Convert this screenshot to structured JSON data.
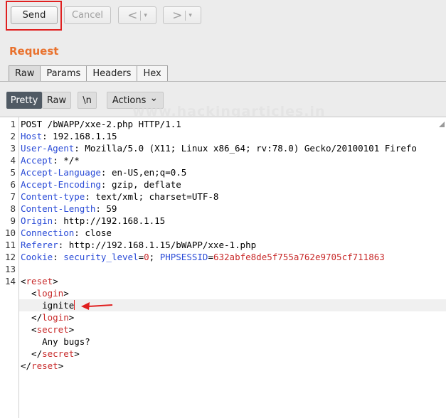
{
  "toolbar": {
    "send_label": "Send",
    "cancel_label": "Cancel",
    "back_glyph": "<",
    "forward_glyph": ">",
    "dropdown_glyph": "▾"
  },
  "request": {
    "title": "Request",
    "tabs": [
      "Raw",
      "Params",
      "Headers",
      "Hex"
    ],
    "active_tab": "Raw"
  },
  "viewbar": {
    "pretty_label": "Pretty",
    "raw_label": "Raw",
    "newline_label": "\\n",
    "actions_label": "Actions",
    "actions_glyph": "⌄"
  },
  "watermark": "www.hackingarticles.in",
  "editor": {
    "lines": [
      {
        "n": "1",
        "text": "POST /bWAPP/xxe-2.php HTTP/1.1"
      },
      {
        "n": "2",
        "key": "Host",
        "value": " 192.168.1.15"
      },
      {
        "n": "3",
        "key": "User-Agent",
        "value": " Mozilla/5.0 (X11; Linux x86_64; rv:78.0) Gecko/20100101 Firefo"
      },
      {
        "n": "4",
        "key": "Accept",
        "value": " */*"
      },
      {
        "n": "5",
        "key": "Accept-Language",
        "value": " en-US,en;q=0.5"
      },
      {
        "n": "6",
        "key": "Accept-Encoding",
        "value": " gzip, deflate"
      },
      {
        "n": "7",
        "key": "Content-type",
        "value": " text/xml; charset=UTF-8"
      },
      {
        "n": "8",
        "key": "Content-Length",
        "value": " 59"
      },
      {
        "n": "9",
        "key": "Origin",
        "value": " http://192.168.1.15"
      },
      {
        "n": "10",
        "key": "Connection",
        "value": " close"
      },
      {
        "n": "11",
        "key": "Referer",
        "value": " http://192.168.1.15/bWAPP/xxe-1.php"
      },
      {
        "n": "12",
        "key": "Cookie",
        "cookie": [
          {
            "name": "security_level",
            "value": "0"
          },
          {
            "name": "PHPSESSID",
            "value": "632abfe8de5f755a762e9705cf711863"
          }
        ]
      },
      {
        "n": "13",
        "text": ""
      },
      {
        "n": "14",
        "xml": "reset",
        "open": true
      },
      {
        "n": "",
        "xml": "login",
        "open": true,
        "indent": "  "
      },
      {
        "n": "",
        "text": "    ignite",
        "caret": true
      },
      {
        "n": "",
        "xml": "login",
        "open": false,
        "indent": "  "
      },
      {
        "n": "",
        "xml": "secret",
        "open": true,
        "indent": "  "
      },
      {
        "n": "",
        "text": "    Any bugs?"
      },
      {
        "n": "",
        "xml": "secret",
        "open": false,
        "indent": "  "
      },
      {
        "n": "",
        "xml": "reset",
        "open": false
      }
    ]
  },
  "colors": {
    "accent": "#e9722e",
    "highlight_box": "#e02020",
    "header_key": "#2a4bd7",
    "xml_tag": "#c82a2a",
    "button_dark": "#505a64"
  }
}
